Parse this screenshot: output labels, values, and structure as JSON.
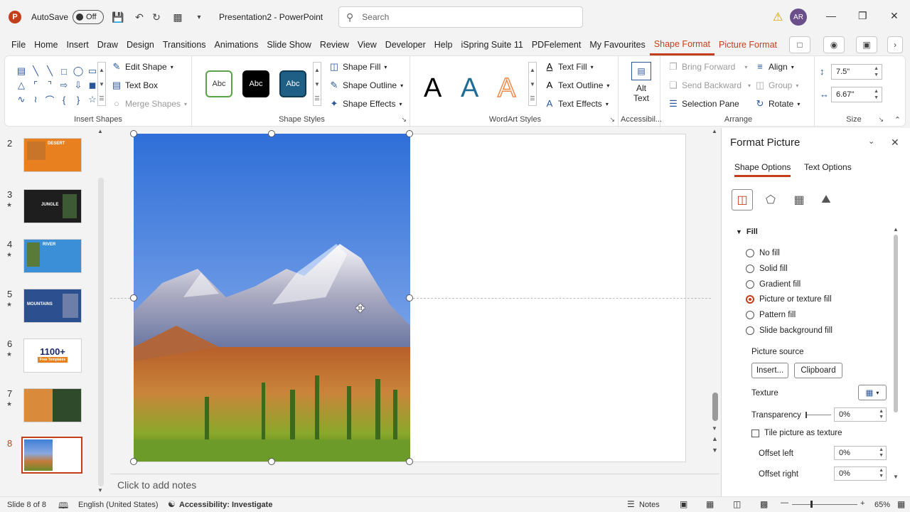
{
  "titlebar": {
    "app_logo": "P",
    "autosave_label": "AutoSave",
    "autosave_state": "Off",
    "doc_title": "Presentation2  -  PowerPoint",
    "search_placeholder": "Search",
    "avatar_initials": "AR"
  },
  "tabs": [
    "File",
    "Home",
    "Insert",
    "Draw",
    "Design",
    "Transitions",
    "Animations",
    "Slide Show",
    "Review",
    "View",
    "Developer",
    "Help",
    "iSpring Suite 11",
    "PDFelement",
    "My Favourites",
    "Shape Format",
    "Picture Format"
  ],
  "active_tab": "Shape Format",
  "ribbon": {
    "insert_shapes": {
      "label": "Insert Shapes",
      "edit_shape": "Edit Shape",
      "text_box": "Text Box",
      "merge_shapes": "Merge Shapes"
    },
    "shape_styles": {
      "label": "Shape Styles",
      "sample": "Abc",
      "shape_fill": "Shape Fill",
      "shape_outline": "Shape Outline",
      "shape_effects": "Shape Effects"
    },
    "wordart": {
      "label": "WordArt Styles",
      "letter": "A",
      "text_fill": "Text Fill",
      "text_outline": "Text Outline",
      "text_effects": "Text Effects"
    },
    "accessibility": {
      "label": "Accessibil...",
      "alt_text_line1": "Alt",
      "alt_text_line2": "Text"
    },
    "arrange": {
      "label": "Arrange",
      "bring_forward": "Bring Forward",
      "send_backward": "Send Backward",
      "selection_pane": "Selection Pane",
      "align": "Align",
      "group": "Group",
      "rotate": "Rotate"
    },
    "size": {
      "label": "Size",
      "height": "7.5\"",
      "width": "6.67\""
    }
  },
  "thumbnails": [
    {
      "num": "2",
      "star": "",
      "title": "DESERT",
      "bg": "#e8801f"
    },
    {
      "num": "3",
      "star": "★",
      "title": "JUNGLE",
      "bg": "#1e1e1e"
    },
    {
      "num": "4",
      "star": "★",
      "title": "RIVER",
      "bg": "#3a8fd6"
    },
    {
      "num": "5",
      "star": "★",
      "title": "MOUNTAINS",
      "bg": "#2c4f8f"
    },
    {
      "num": "6",
      "star": "★",
      "title": "1100+",
      "bg": "#ffffff"
    },
    {
      "num": "7",
      "star": "★",
      "title": "",
      "bg": "#c46a2a"
    },
    {
      "num": "8",
      "star": "",
      "title": "",
      "bg": "#ffffff"
    }
  ],
  "thumb6_sub": "Free Templates",
  "notes_placeholder": "Click to add notes",
  "format_pane": {
    "title": "Format Picture",
    "tabs": [
      "Shape Options",
      "Text Options"
    ],
    "section": "Fill",
    "fill_options": [
      "No fill",
      "Solid fill",
      "Gradient fill",
      "Picture or texture fill",
      "Pattern fill",
      "Slide background fill"
    ],
    "selected_fill": "Picture or texture fill",
    "picture_source": "Picture source",
    "insert_btn": "Insert...",
    "clipboard_btn": "Clipboard",
    "texture": "Texture",
    "transparency": "Transparency",
    "transparency_value": "0%",
    "tile": "Tile picture as texture",
    "offset_left": "Offset left",
    "offset_left_value": "0%",
    "offset_right": "Offset right",
    "offset_right_value": "0%"
  },
  "status": {
    "slide": "Slide 8 of 8",
    "language": "English (United States)",
    "accessibility": "Accessibility: Investigate",
    "notes": "Notes",
    "zoom": "65%"
  },
  "colors": {
    "accent": "#c43e1c",
    "style_blue": "#1f5f86",
    "wordart_blue": "#1f6d96",
    "wordart_orange": "#f08a4b"
  }
}
